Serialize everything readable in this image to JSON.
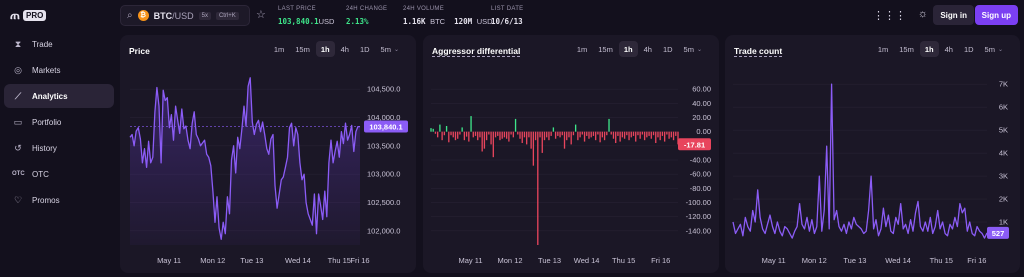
{
  "app": {
    "logo_text": "PRO"
  },
  "sidebar": {
    "items": [
      {
        "label": "Trade",
        "icon": "trade-icon",
        "glyph": "⧗",
        "active": false
      },
      {
        "label": "Markets",
        "icon": "markets-icon",
        "glyph": "◎",
        "active": false
      },
      {
        "label": "Analytics",
        "icon": "analytics-icon",
        "glyph": "⟋",
        "active": true
      },
      {
        "label": "Portfolio",
        "icon": "portfolio-icon",
        "glyph": "▭",
        "active": false
      },
      {
        "label": "History",
        "icon": "history-icon",
        "glyph": "↺",
        "active": false
      },
      {
        "label": "OTC",
        "icon": "otc-icon",
        "glyph": "OTC",
        "active": false
      },
      {
        "label": "Promos",
        "icon": "promos-icon",
        "glyph": "♡",
        "active": false
      }
    ]
  },
  "header": {
    "pair_base": "BTC",
    "pair_quote": "/USD",
    "leverage": "5x",
    "shortcut": "Ctrl+K",
    "last_price_label": "LAST PRICE",
    "last_price": "103,840.1",
    "last_price_unit": "USD",
    "change_label": "24H CHANGE",
    "change": "2.13%",
    "volume_label": "24H VOLUME",
    "volume_btc": "1.16K",
    "volume_btc_unit": "BTC",
    "volume_usd": "120M",
    "volume_usd_unit": "USD",
    "list_date_label": "LIST DATE",
    "list_date": "10/6/13",
    "sign_in": "Sign in",
    "sign_up": "Sign up"
  },
  "intervals": [
    "1m",
    "15m",
    "1h",
    "4h",
    "1D",
    "5m"
  ],
  "active_interval": "1h",
  "colors": {
    "accent": "#7b3ff2",
    "line": "#8b5cf6",
    "positive": "#3ee58a",
    "negative": "#e8455d"
  },
  "chart_data": [
    {
      "type": "area",
      "title": "Price",
      "ylim": [
        101750,
        104750
      ],
      "y_ticks": [
        "104,500.0",
        "104,000.0",
        "103,500.0",
        "103,000.0",
        "102,500.0",
        "102,000.0"
      ],
      "x_ticks": [
        "May 11",
        "Mon 12",
        "Tue 13",
        "Wed 14",
        "Thu 15",
        "Fri 16"
      ],
      "current_value": "103,840.1",
      "values": [
        103650,
        103700,
        103500,
        103760,
        103820,
        103620,
        103200,
        103450,
        103120,
        103580,
        103200,
        103300,
        104100,
        104530,
        104200,
        103200,
        104480,
        104300,
        104350,
        103820,
        104050,
        103600,
        104200,
        103950,
        103720,
        104150,
        103800,
        103850,
        103600,
        103450,
        103900,
        104100,
        103700,
        103620,
        103500,
        103550,
        103600,
        103350,
        103300,
        103150,
        102700,
        102150,
        102600,
        102050,
        101850,
        102150,
        101950,
        102600,
        102300,
        103250,
        103500,
        103020,
        103650,
        103450,
        103800,
        104200,
        103850,
        104550,
        104700,
        103920,
        103700,
        103880,
        103950,
        103750,
        103920,
        103700,
        103450,
        103350,
        103620,
        103700,
        102800,
        102400,
        102650,
        102900,
        102950,
        103120,
        103300,
        103820,
        103900,
        103500,
        103820,
        103700,
        103200,
        102900,
        103000,
        102500,
        102300,
        102200,
        102100,
        102650,
        101950,
        102650,
        102450,
        102200,
        102700,
        102250,
        103200,
        103600,
        103200,
        103400,
        103580,
        103300,
        103750,
        103540,
        103900,
        103600,
        103700,
        103860,
        103400,
        103750,
        103840,
        103840
      ]
    },
    {
      "type": "bar",
      "title": "Aggressor differential",
      "ylim": [
        -160,
        80
      ],
      "y_ticks": [
        "60.00",
        "40.00",
        "20.00",
        "0.00",
        "-20.00",
        "-40.00",
        "-60.00",
        "-80.00",
        "-100.00",
        "-120.00",
        "-140.00"
      ],
      "x_ticks": [
        "May 11",
        "Mon 12",
        "Tue 13",
        "Wed 14",
        "Thu 15",
        "Fri 16"
      ],
      "current_value": "-17.81",
      "values": [
        5,
        4,
        -3,
        -8,
        10,
        -12,
        -5,
        8,
        -15,
        -5,
        -8,
        -12,
        -10,
        -4,
        6,
        -12,
        -7,
        -14,
        22,
        -8,
        -6,
        -12,
        -8,
        -28,
        -24,
        -12,
        -4,
        -18,
        -36,
        -8,
        -6,
        -12,
        -10,
        -8,
        -10,
        -14,
        -4,
        -8,
        18,
        -4,
        -10,
        -16,
        -8,
        -18,
        -8,
        -24,
        -48,
        -12,
        -160,
        -8,
        -30,
        -12,
        -8,
        -12,
        -6,
        6,
        -10,
        -6,
        -8,
        -5,
        -24,
        -12,
        -8,
        -18,
        -5,
        10,
        -12,
        -8,
        -4,
        -14,
        -6,
        -10,
        -8,
        -6,
        -12,
        -4,
        -15,
        -8,
        -12,
        -5,
        18,
        -4,
        -10,
        -16,
        -6,
        -14,
        -8,
        -10,
        -5,
        -12,
        -8,
        -6,
        -14,
        -5,
        -10,
        -4,
        -12,
        -8,
        -6,
        -10,
        -5,
        -16,
        -8,
        -12,
        -6,
        -14,
        -4,
        -10,
        -8,
        -12,
        -6,
        -18
      ]
    },
    {
      "type": "line",
      "title": "Trade count",
      "ylim": [
        0,
        7400
      ],
      "y_ticks": [
        "7K",
        "6K",
        "5K",
        "4K",
        "3K",
        "2K",
        "1K"
      ],
      "x_ticks": [
        "May 11",
        "Mon 12",
        "Tue 13",
        "Wed 14",
        "Thu 15",
        "Fri 16"
      ],
      "current_value": "527",
      "values": [
        1000,
        500,
        700,
        900,
        400,
        1200,
        800,
        600,
        1500,
        1000,
        2400,
        1200,
        700,
        500,
        900,
        1300,
        800,
        500,
        1000,
        600,
        400,
        800,
        700,
        500,
        300,
        600,
        800,
        1800,
        900,
        700,
        1200,
        600,
        1100,
        500,
        800,
        3000,
        600,
        1500,
        4300,
        700,
        7000,
        1100,
        1500,
        800,
        600,
        900,
        500,
        1000,
        700,
        1200,
        900,
        800,
        700,
        500,
        600,
        1500,
        3000,
        700,
        1100,
        400,
        700,
        1600,
        800,
        1300,
        600,
        500,
        1200,
        900,
        1800,
        700,
        900,
        500,
        1100,
        600,
        1400,
        1900,
        800,
        600,
        1000,
        600,
        1200,
        500,
        800,
        1500,
        700,
        1000,
        500,
        400,
        900,
        700,
        1200,
        800,
        1800,
        1400,
        1600,
        600,
        1000,
        500,
        400,
        800,
        600,
        500,
        300,
        527
      ]
    }
  ]
}
